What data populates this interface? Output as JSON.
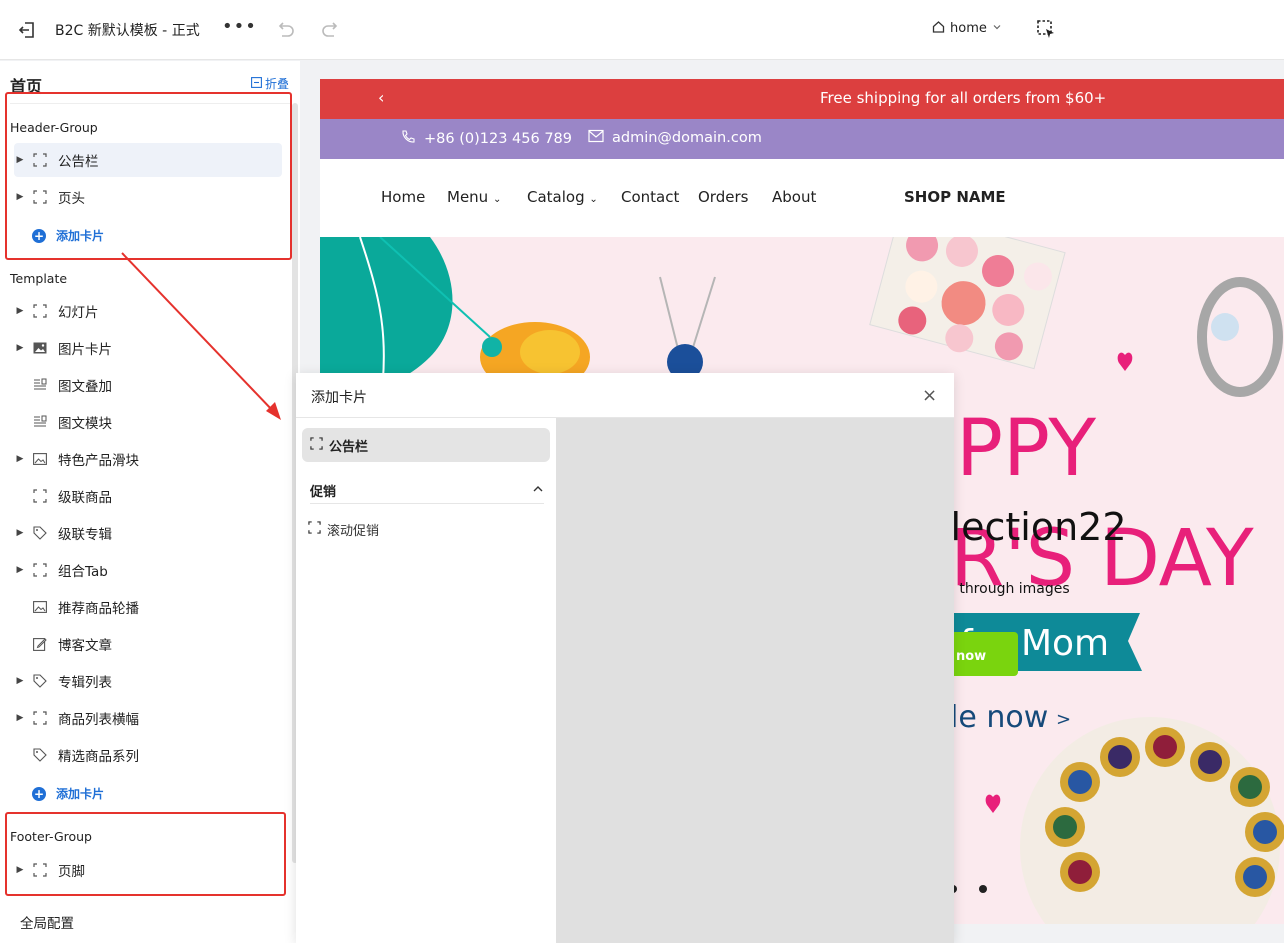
{
  "topbar": {
    "title": "B2C 新默认模板 - 正式",
    "more": "•••",
    "page_select": "home",
    "icons": [
      "exit-icon",
      "undo-icon",
      "redo-icon",
      "select-tool-icon"
    ]
  },
  "left": {
    "heading": "首页",
    "collapse_label": "折叠",
    "header_group": {
      "label": "Header-Group",
      "items": [
        {
          "label": "公告栏",
          "icon": "dashed-square-icon",
          "expandable": true
        },
        {
          "label": "页头",
          "icon": "dashed-square-icon",
          "expandable": true
        }
      ],
      "add_label": "添加卡片"
    },
    "template": {
      "label": "Template",
      "items": [
        {
          "label": "幻灯片",
          "icon": "dashed-square-icon",
          "expandable": true
        },
        {
          "label": "图片卡片",
          "icon": "image-icon",
          "expandable": true
        },
        {
          "label": "图文叠加",
          "icon": "text-image-icon",
          "expandable": false
        },
        {
          "label": "图文模块",
          "icon": "text-image-icon",
          "expandable": false
        },
        {
          "label": "特色产品滑块",
          "icon": "picture-icon",
          "expandable": true
        },
        {
          "label": "级联商品",
          "icon": "dashed-square-icon",
          "expandable": false
        },
        {
          "label": "级联专辑",
          "icon": "tag-icon",
          "expandable": true
        },
        {
          "label": "组合Tab",
          "icon": "dashed-square-icon",
          "expandable": true
        },
        {
          "label": "推荐商品轮播",
          "icon": "picture-icon",
          "expandable": false
        },
        {
          "label": "博客文章",
          "icon": "edit-icon",
          "expandable": false
        },
        {
          "label": "专辑列表",
          "icon": "tag-icon",
          "expandable": true
        },
        {
          "label": "商品列表横幅",
          "icon": "dashed-square-icon",
          "expandable": true
        },
        {
          "label": "精选商品系列",
          "icon": "tag-icon",
          "expandable": false
        }
      ],
      "add_label": "添加卡片"
    },
    "footer_group": {
      "label": "Footer-Group",
      "items": [
        {
          "label": "页脚",
          "icon": "dashed-square-icon",
          "expandable": true
        }
      ]
    },
    "global_config": "全局配置"
  },
  "preview": {
    "announcement": "Free shipping for all orders from $60+",
    "phone": "+86 (0)123 456 789",
    "email": "admin@domain.com",
    "nav": [
      "Home",
      "Menu",
      "Catalog",
      "Contact",
      "Orders",
      "About"
    ],
    "shop_name": "SHOP NAME",
    "hero": {
      "headline_1": "PPY",
      "headline_2": "llection22",
      "headline_3": "R'S DAY",
      "sub": "n through images",
      "banner": "for Mom",
      "btn": "now",
      "cta": "le now",
      "cta_arrow": ">"
    }
  },
  "modal": {
    "title": "添加卡片",
    "close": "×",
    "selected_item": "公告栏",
    "section": "促销",
    "items": [
      "滚动促销"
    ]
  },
  "colors": {
    "accent": "#1f6fd6",
    "announcement_bg": "#dc3f3f",
    "contact_bg": "#9a86c7",
    "annotation_red": "#e5322d",
    "hero_pink": "#e8207a",
    "hero_teal": "#0e8a98",
    "hero_green": "#7ad40e"
  }
}
